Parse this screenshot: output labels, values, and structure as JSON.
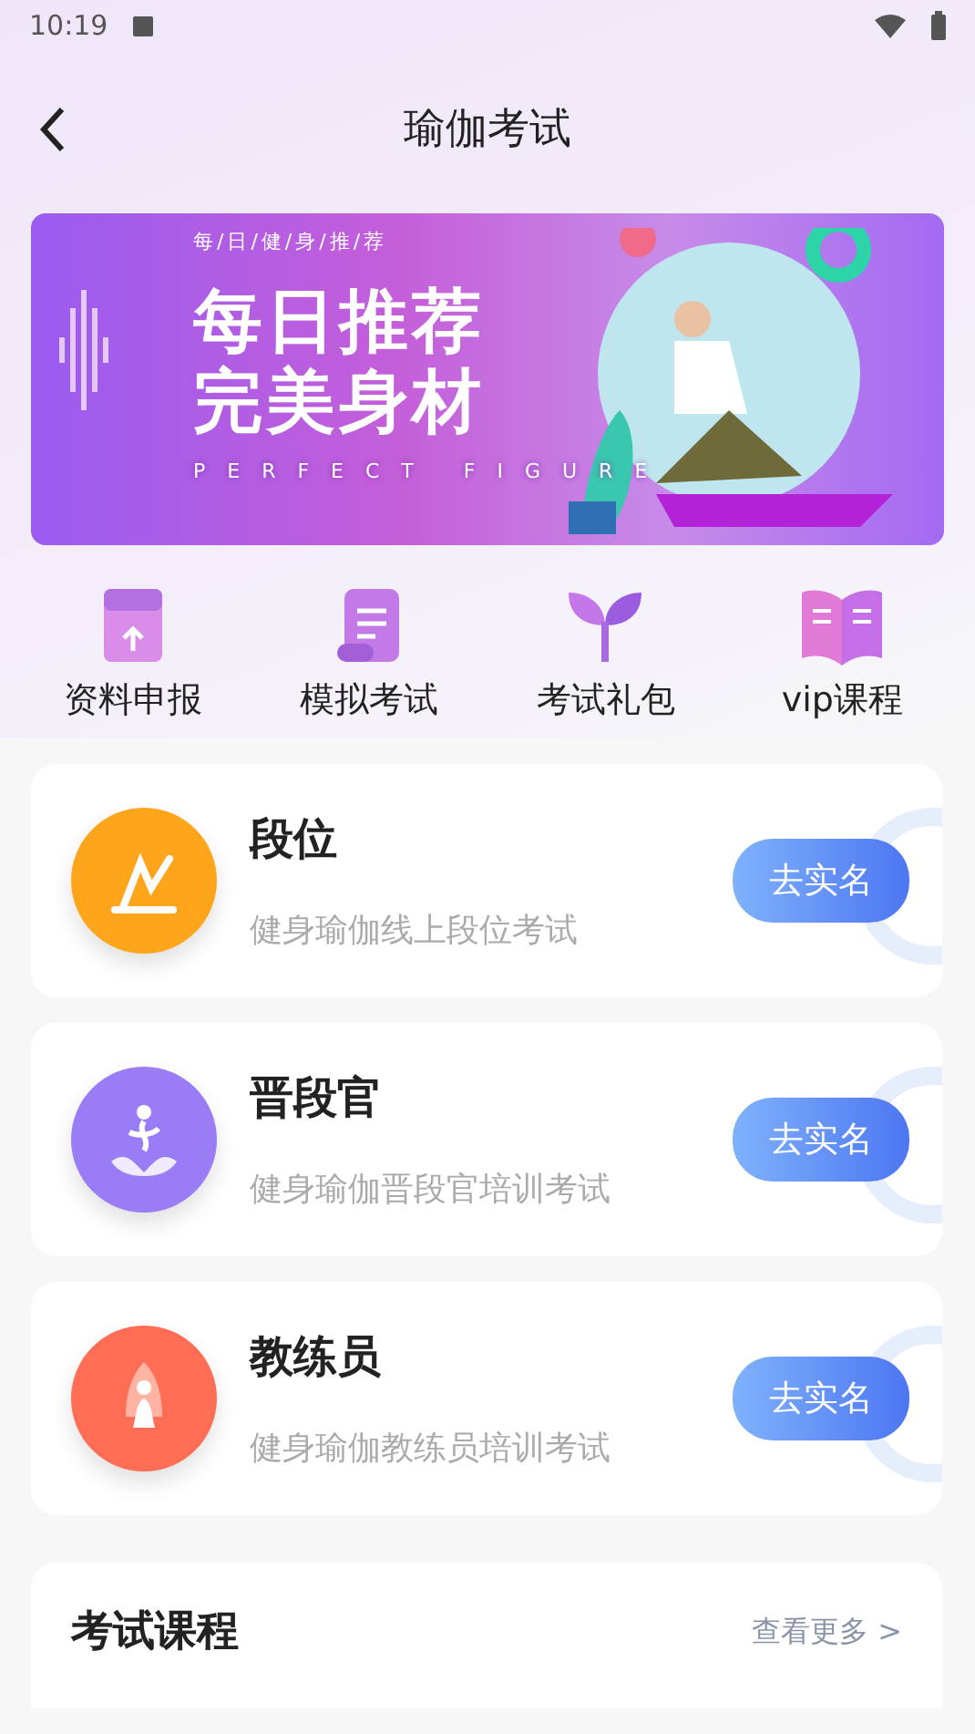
{
  "status_bar": {
    "time": "10:19"
  },
  "header": {
    "title": "瑜伽考试"
  },
  "banner": {
    "tagline": "每/日/健/身/推/荐",
    "headline_1": "每日推荐",
    "headline_2": "完美身材",
    "subline": "PERFECT FIGURE"
  },
  "shortcuts": [
    {
      "label": "资料申报",
      "kind": "file"
    },
    {
      "label": "模拟考试",
      "kind": "scroll"
    },
    {
      "label": "考试礼包",
      "kind": "sprout"
    },
    {
      "label": "vip课程",
      "kind": "book"
    }
  ],
  "exams": [
    {
      "title": "段位",
      "subtitle": "健身瑜伽线上段位考试",
      "button": "去实名",
      "color": "#ffa51c",
      "kind": "pose"
    },
    {
      "title": "晋段官",
      "subtitle": "健身瑜伽晋段官培训考试",
      "button": "去实名",
      "color": "#9b7cf7",
      "kind": "lotus"
    },
    {
      "title": "教练员",
      "subtitle": "健身瑜伽教练员培训考试",
      "button": "去实名",
      "color": "#ff6d55",
      "kind": "meditate"
    }
  ],
  "courses": {
    "title": "考试课程",
    "more": "查看更多 >"
  }
}
